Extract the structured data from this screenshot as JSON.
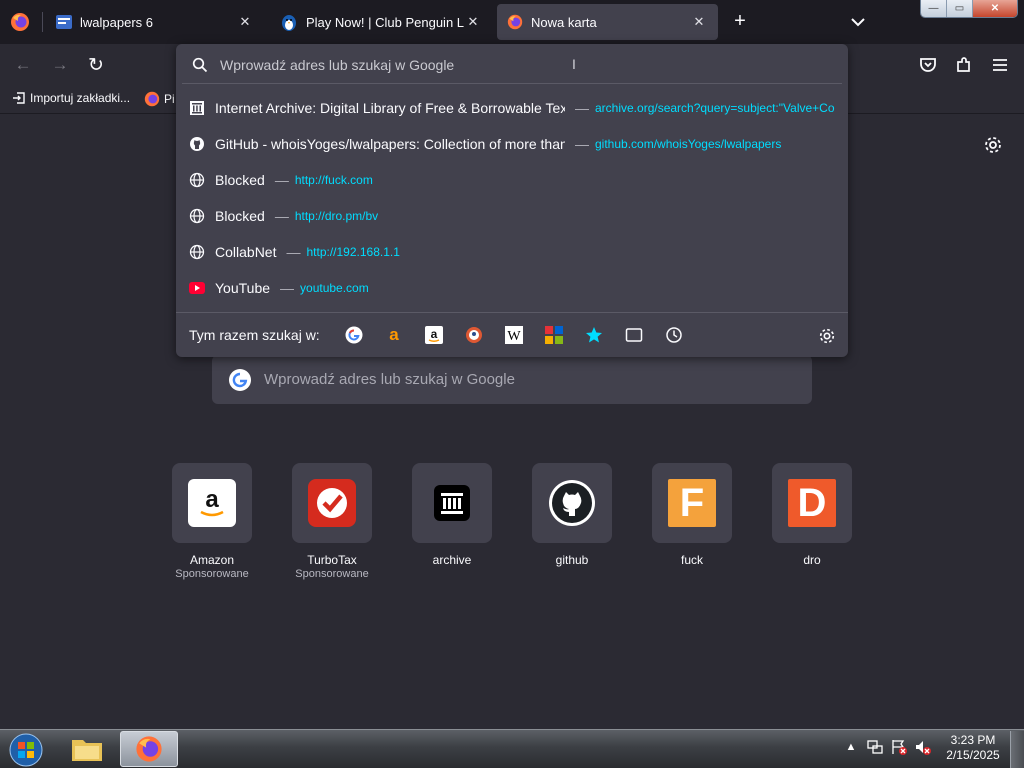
{
  "tabs": [
    {
      "title": "lwalpapers 6"
    },
    {
      "title": "Play Now! | Club Penguin Legacy"
    },
    {
      "title": "Nowa karta"
    }
  ],
  "tab_close_glyph": "✕",
  "new_tab_glyph": "+",
  "window_controls": {
    "minimize": "—",
    "maximize": "▭",
    "close": "✕"
  },
  "nav": {
    "back": "←",
    "forward": "→",
    "reload": "↻"
  },
  "bookmarks": [
    {
      "label": "Importuj zakładki...",
      "icon": "import-icon"
    },
    {
      "label": "Pi",
      "icon": "firefox-icon"
    }
  ],
  "urlbar": {
    "placeholder": "Wprowadź adres lub szukaj w Google",
    "value": ""
  },
  "suggestions": [
    {
      "title": "Internet Archive: Digital Library of Free & Borrowable Texts",
      "url": "archive.org/search?query=subject:\"Valve+Co",
      "icon": "archive-icon"
    },
    {
      "title": "GitHub - whoisYoges/lwalpapers: Collection of more than",
      "url": "github.com/whoisYoges/lwalpapers",
      "icon": "github-icon"
    },
    {
      "title": "Blocked",
      "url": "http://fuck.com",
      "icon": "globe-icon"
    },
    {
      "title": "Blocked",
      "url": "http://dro.pm/bv",
      "icon": "globe-icon"
    },
    {
      "title": "CollabNet",
      "url": "http://192.168.1.1",
      "icon": "globe-icon"
    },
    {
      "title": "YouTube",
      "url": "youtube.com",
      "icon": "youtube-icon"
    }
  ],
  "dash": "—",
  "engines_label": "Tym razem szukaj w:",
  "engines": [
    "google-icon",
    "amazon-a-icon",
    "amazon-icon",
    "duckduckgo-icon",
    "wikipedia-icon",
    "ebay-icon",
    "bookmarks-star-icon",
    "tabs-icon",
    "history-icon"
  ],
  "page_search_placeholder": "Wprowadź adres lub szukaj w Google",
  "top_sites": [
    {
      "label": "Amazon",
      "sub": "Sponsorowane",
      "letter": "a",
      "bg": "#ffffff",
      "fg": "#111111"
    },
    {
      "label": "TurboTax",
      "sub": "Sponsorowane",
      "letter": "✓",
      "bg": "#d52b1e",
      "fg": "#ffffff"
    },
    {
      "label": "archive",
      "sub": "",
      "letter": "🏛",
      "bg": "#000000",
      "fg": "#ffffff"
    },
    {
      "label": "github",
      "sub": "",
      "letter": "",
      "bg": "#ffffff",
      "fg": "#000000"
    },
    {
      "label": "fuck",
      "sub": "",
      "letter": "F",
      "bg": "#f4a23c",
      "fg": "#ffffff"
    },
    {
      "label": "dro",
      "sub": "",
      "letter": "D",
      "bg": "#ef5a2b",
      "fg": "#ffffff"
    }
  ],
  "taskbar": {
    "time": "3:23 PM",
    "date": "2/15/2025"
  },
  "colors": {
    "url": "#00ddff",
    "background": "#2b2a33",
    "panel": "#42414d"
  }
}
